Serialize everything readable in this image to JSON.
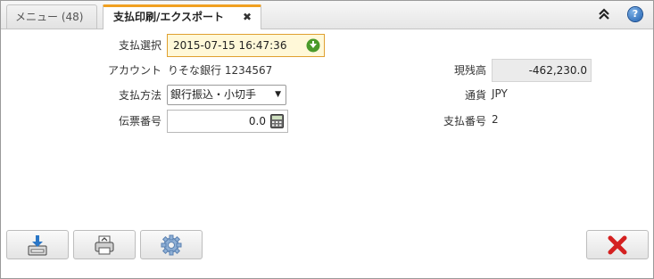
{
  "tabs": [
    {
      "label": "メニュー (48)"
    },
    {
      "label": "支払印刷/エクスポート",
      "close": "✖"
    }
  ],
  "help_glyph": "?",
  "form": {
    "payment_select_label": "支払選択",
    "payment_select_value": "2015-07-15 16:47:36",
    "account_label": "アカウント",
    "account_value": "りそな銀行 1234567",
    "balance_label": "現残高",
    "balance_value": "-462,230.0",
    "payment_method_label": "支払方法",
    "payment_method_value": "銀行振込・小切手",
    "currency_label": "通貨",
    "currency_value": "JPY",
    "document_no_label": "伝票番号",
    "document_no_value": "0.0",
    "payment_no_label": "支払番号",
    "payment_no_value": "2"
  },
  "icons": {
    "collapse": "double-chevron-up-icon",
    "help": "help-icon",
    "date_pick": "green-arrow-icon",
    "calculator": "calculator-icon",
    "export": "export-icon",
    "print": "printer-icon",
    "settings": "gear-icon",
    "cancel": "red-x-icon"
  },
  "colors": {
    "active_tab_accent": "#f0a020",
    "date_field_bg": "#fff8d8",
    "cancel_red": "#d42020"
  }
}
